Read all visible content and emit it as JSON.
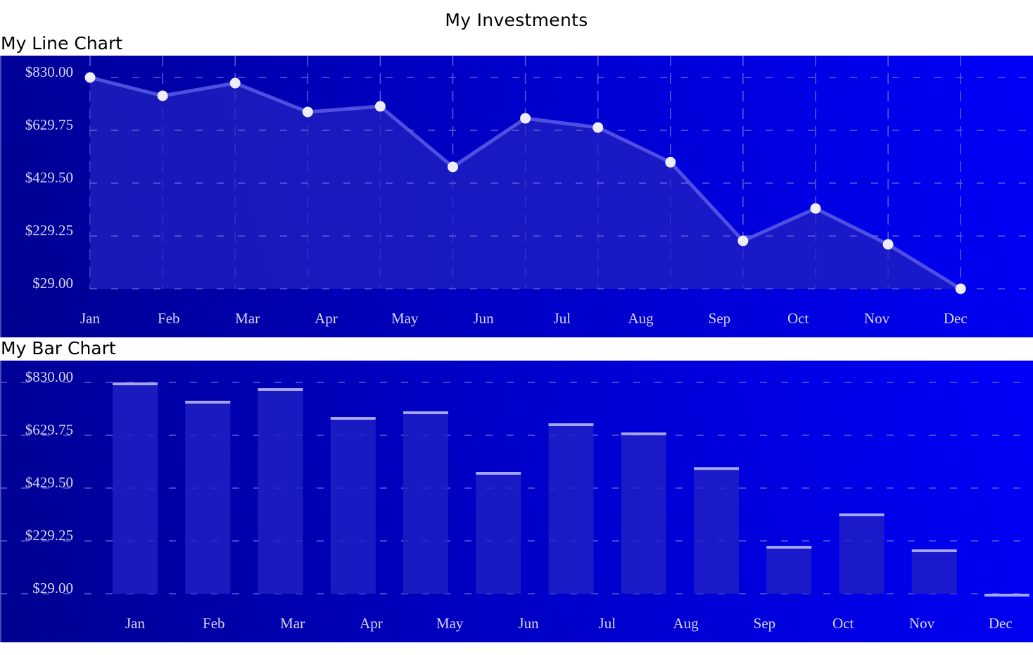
{
  "page": {
    "title": "My Investments"
  },
  "chart_data": [
    {
      "id": "line",
      "type": "area",
      "title": "My Line Chart",
      "xlabel": "",
      "ylabel": "",
      "x_tick_labels": [
        "Jan",
        "Feb",
        "Mar",
        "Apr",
        "May",
        "Jun",
        "Jul",
        "Aug",
        "Sep",
        "Oct",
        "Nov",
        "Dec"
      ],
      "values": [
        830,
        760.6,
        808.6,
        699.2,
        720.5,
        490.9,
        675.1,
        640.4,
        508.9,
        210.6,
        333.4,
        197.2,
        29
      ],
      "y_ticks": [
        29.0,
        229.25,
        429.5,
        629.75,
        830.0
      ],
      "y_tick_labels": [
        "$29.00",
        "$229.25",
        "$429.50",
        "$629.75",
        "$830.00"
      ],
      "ylim": [
        29,
        830
      ],
      "grid": true,
      "grid_style": "dashed",
      "legend": "none",
      "colors": {
        "line": "#5a5ae6",
        "point": "#ececfb",
        "fill": "#2222c0",
        "grid": "#5c5cd6",
        "tick_text": "#d6d6f5"
      }
    },
    {
      "id": "bar",
      "type": "bar",
      "title": "My Bar Chart",
      "xlabel": "",
      "ylabel": "",
      "x_tick_labels": [
        "Jan",
        "Feb",
        "Mar",
        "Apr",
        "May",
        "Jun",
        "Jul",
        "Aug",
        "Sep",
        "Oct",
        "Nov",
        "Dec"
      ],
      "values": [
        830,
        760.6,
        808.6,
        699.2,
        720.5,
        490.9,
        675.1,
        640.4,
        508.9,
        210.6,
        333.4,
        197.2,
        29
      ],
      "y_ticks": [
        29.0,
        229.25,
        429.5,
        629.75,
        830.0
      ],
      "y_tick_labels": [
        "$29.00",
        "$229.25",
        "$429.50",
        "$629.75",
        "$830.00"
      ],
      "ylim": [
        29,
        830
      ],
      "grid": true,
      "grid_style": "dashed",
      "legend": "none",
      "colors": {
        "bar": "#2020c4",
        "bar_cap": "#a5a5ee",
        "grid": "#5c5cd6",
        "tick_text": "#d6d6f5"
      }
    }
  ]
}
